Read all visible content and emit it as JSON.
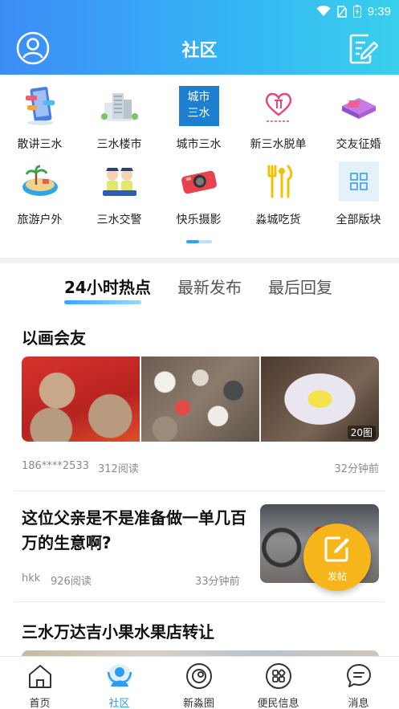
{
  "status_bar": {
    "time": "9:39"
  },
  "header": {
    "title": "社区"
  },
  "categories": [
    {
      "label": "散讲三水",
      "icon": "phone-chat-icon"
    },
    {
      "label": "三水楼市",
      "icon": "buildings-icon"
    },
    {
      "label": "城市三水",
      "icon": "city-logo-icon",
      "logo_text_line1": "城市",
      "logo_text_line2": "三水"
    },
    {
      "label": "新三水脱单",
      "icon": "heart-logo-icon"
    },
    {
      "label": "交友征婚",
      "icon": "gift-box-icon"
    },
    {
      "label": "旅游户外",
      "icon": "island-icon"
    },
    {
      "label": "三水交警",
      "icon": "traffic-police-icon"
    },
    {
      "label": "快乐摄影",
      "icon": "camera-icon"
    },
    {
      "label": "淼城吃货",
      "icon": "fork-knife-icon"
    },
    {
      "label": "全部版块",
      "icon": "grid-icon"
    }
  ],
  "tabs": [
    {
      "label": "24小时热点",
      "active": true
    },
    {
      "label": "最新发布",
      "active": false
    },
    {
      "label": "最后回复",
      "active": false
    }
  ],
  "posts": [
    {
      "title": "以画会友",
      "image_count": "20图",
      "author": "186****2533",
      "reads": "312阅读",
      "time": "32分钟前"
    },
    {
      "title": "这位父亲是不是准备做一单几百万的生意啊?",
      "author": "hkk",
      "reads": "926阅读",
      "time": "33分钟前"
    },
    {
      "title": "三水万达吉小果水果店转让"
    }
  ],
  "fab": {
    "label": "发帖"
  },
  "nav": [
    {
      "label": "首页",
      "icon": "home-icon",
      "active": false
    },
    {
      "label": "社区",
      "icon": "community-icon",
      "active": true
    },
    {
      "label": "新淼圈",
      "icon": "circle-icon",
      "active": false
    },
    {
      "label": "便民信息",
      "icon": "services-icon",
      "active": false
    },
    {
      "label": "消息",
      "icon": "message-icon",
      "active": false
    }
  ],
  "colors": {
    "header_start": "#3d8cf6",
    "header_end": "#39d0ec",
    "accent": "#2f9cf4",
    "fab": "#f7b51c"
  }
}
